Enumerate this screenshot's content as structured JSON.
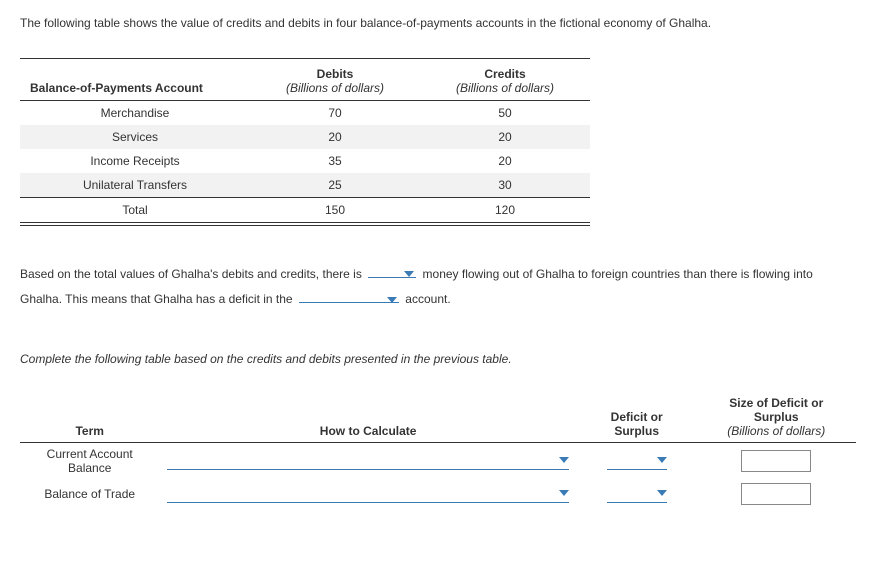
{
  "intro": "The following table shows the value of credits and debits in four balance-of-payments accounts in the fictional economy of Ghalha.",
  "table1": {
    "headers": {
      "c0": "Balance-of-Payments Account",
      "c1_title": "Debits",
      "c1_sub": "(Billions of dollars)",
      "c2_title": "Credits",
      "c2_sub": "(Billions of dollars)"
    },
    "rows": [
      {
        "label": "Merchandise",
        "debits": "70",
        "credits": "50"
      },
      {
        "label": "Services",
        "debits": "20",
        "credits": "20"
      },
      {
        "label": "Income Receipts",
        "debits": "35",
        "credits": "20"
      },
      {
        "label": "Unilateral Transfers",
        "debits": "25",
        "credits": "30"
      }
    ],
    "total": {
      "label": "Total",
      "debits": "150",
      "credits": "120"
    }
  },
  "para": {
    "p1": "Based on the total values of Ghalha's debits and credits, there is",
    "p2": "money flowing out of Ghalha to foreign countries than there is flowing into Ghalha. This means that Ghalha has a deficit in the",
    "p3": "account."
  },
  "instr": "Complete the following table based on the credits and debits presented in the previous table.",
  "table2": {
    "headers": {
      "term": "Term",
      "calc": "How to Calculate",
      "ds_l1": "Deficit or",
      "ds_l2": "Surplus",
      "sz_l1": "Size of Deficit or",
      "sz_l2": "Surplus",
      "sz_sub": "(Billions of dollars)"
    },
    "rows": [
      {
        "term_l1": "Current Account",
        "term_l2": "Balance"
      },
      {
        "term_l1": "Balance of Trade",
        "term_l2": ""
      }
    ]
  },
  "chart_data": {
    "type": "table",
    "title": "Balance-of-Payments Accounts (Billions of dollars)",
    "columns": [
      "Account",
      "Debits",
      "Credits"
    ],
    "rows": [
      [
        "Merchandise",
        70,
        50
      ],
      [
        "Services",
        20,
        20
      ],
      [
        "Income Receipts",
        35,
        20
      ],
      [
        "Unilateral Transfers",
        25,
        30
      ],
      [
        "Total",
        150,
        120
      ]
    ]
  }
}
